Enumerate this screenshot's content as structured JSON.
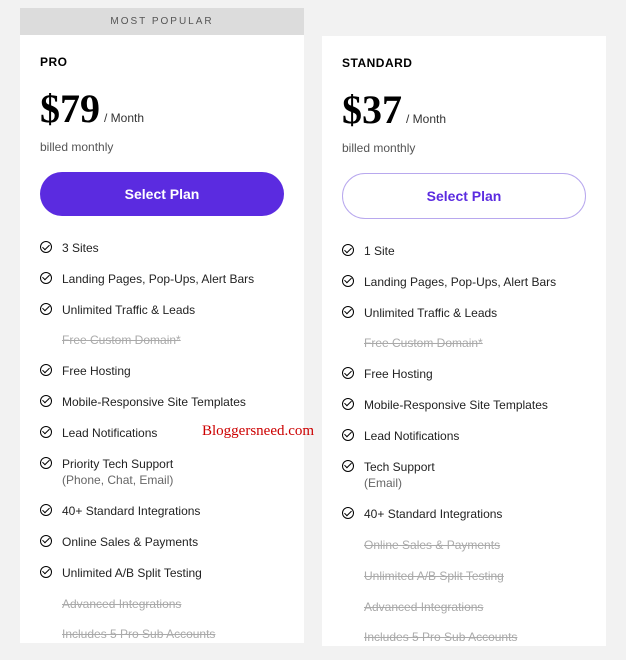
{
  "badge": "MOST POPULAR",
  "watermark": "Bloggersneed.com",
  "plans": {
    "pro": {
      "name": "PRO",
      "price": "$79",
      "period": "/ Month",
      "billing": "billed monthly",
      "cta": "Select Plan",
      "features": [
        {
          "label": "3 Sites",
          "struck": false
        },
        {
          "label": "Landing Pages, Pop-Ups, Alert Bars",
          "struck": false
        },
        {
          "label": "Unlimited Traffic & Leads",
          "struck": false
        },
        {
          "label": "Free Custom Domain*",
          "struck": true
        },
        {
          "label": "Free Hosting",
          "struck": false
        },
        {
          "label": "Mobile-Responsive Site Templates",
          "struck": false
        },
        {
          "label": "Lead Notifications",
          "struck": false
        },
        {
          "label": "Priority Tech Support",
          "sub": "(Phone, Chat, Email)",
          "struck": false
        },
        {
          "label": "40+ Standard Integrations",
          "struck": false
        },
        {
          "label": "Online Sales & Payments",
          "struck": false
        },
        {
          "label": "Unlimited A/B Split Testing",
          "struck": false
        },
        {
          "label": "Advanced Integrations",
          "struck": true
        },
        {
          "label": "Includes 5 Pro Sub Accounts",
          "struck": true
        }
      ]
    },
    "standard": {
      "name": "STANDARD",
      "price": "$37",
      "period": "/ Month",
      "billing": "billed monthly",
      "cta": "Select Plan",
      "features": [
        {
          "label": "1 Site",
          "struck": false
        },
        {
          "label": "Landing Pages, Pop-Ups, Alert Bars",
          "struck": false
        },
        {
          "label": "Unlimited Traffic & Leads",
          "struck": false
        },
        {
          "label": "Free Custom Domain*",
          "struck": true
        },
        {
          "label": "Free Hosting",
          "struck": false
        },
        {
          "label": "Mobile-Responsive Site Templates",
          "struck": false
        },
        {
          "label": "Lead Notifications",
          "struck": false
        },
        {
          "label": "Tech Support",
          "sub": "(Email)",
          "struck": false
        },
        {
          "label": "40+ Standard Integrations",
          "struck": false
        },
        {
          "label": "Online Sales & Payments",
          "struck": true
        },
        {
          "label": "Unlimited A/B Split Testing",
          "struck": true
        },
        {
          "label": "Advanced Integrations",
          "struck": true
        },
        {
          "label": "Includes 5 Pro Sub Accounts",
          "struck": true
        }
      ]
    }
  }
}
